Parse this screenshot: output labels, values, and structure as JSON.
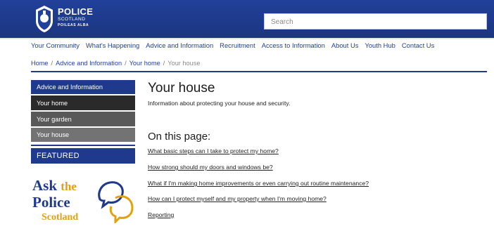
{
  "header": {
    "logo_title": "POLICE",
    "logo_sub": "SCOTLAND",
    "logo_sub2": "POILEAS ALBA",
    "search_placeholder": "Search"
  },
  "nav": {
    "items": [
      "Your Community",
      "What's Happening",
      "Advice and Information",
      "Recruitment",
      "Access to Information",
      "About Us",
      "Youth Hub",
      "Contact Us"
    ]
  },
  "breadcrumb": {
    "items": [
      "Home",
      "Advice and Information",
      "Your home"
    ],
    "current": "Your house",
    "separator": "/"
  },
  "sidebar": {
    "items": [
      "Advice and Information",
      "Your home",
      "Your garden",
      "Your house"
    ],
    "featured": "FEATURED"
  },
  "ask_logo": {
    "ask": "Ask",
    "the": "the",
    "police": "Police",
    "scotland": "Scotland"
  },
  "main": {
    "title": "Your house",
    "intro": "Information about protecting your house and security.",
    "on_this_page": "On this page:",
    "links": [
      "What basic steps can I take to protect my home?",
      "How strong should my doors and windows be?",
      "What if I'm making home improvements or even carrying out routine maintenance?",
      "How can I protect myself and my property when I'm moving home?",
      "Reporting"
    ]
  },
  "colors": {
    "brand_blue": "#1f3a8c",
    "accent_gold": "#e0a112"
  }
}
